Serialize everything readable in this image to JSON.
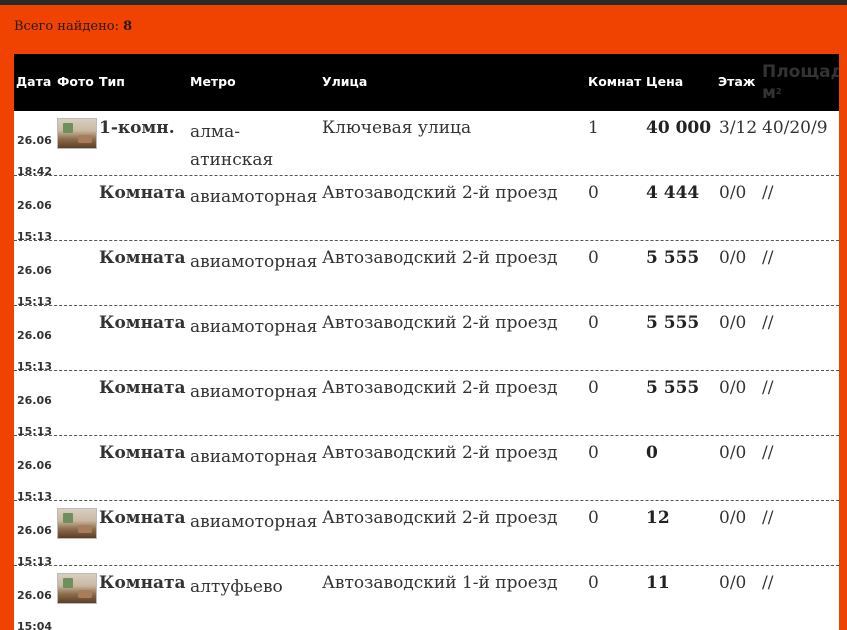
{
  "summary": {
    "label": "Всего найдено:",
    "count": "8"
  },
  "columns": {
    "date": "Дата",
    "photo": "Фото",
    "type": "Тип",
    "metro": "Метро",
    "street": "Улица",
    "rooms": "Комнат",
    "price": "Цена",
    "floor": "Этаж",
    "area": "Площадь",
    "area_unit": "м",
    "area_sup": "2"
  },
  "rows": [
    {
      "date": "26.06",
      "time": "18:42",
      "photo": true,
      "type": "1-комн.",
      "metro": "алма-",
      "metro2": "атинская",
      "street": "Ключевая улица",
      "rooms": "1",
      "price": "40 000",
      "floor": "3/12",
      "area": "40/20/9"
    },
    {
      "date": "26.06",
      "time": "15:13",
      "photo": false,
      "type": "Комната",
      "metro": "авиамоторная",
      "metro2": "",
      "street": "Автозаводский 2-й проезд",
      "rooms": "0",
      "price": "4 444",
      "floor": "0/0",
      "area": "//"
    },
    {
      "date": "26.06",
      "time": "15:13",
      "photo": false,
      "type": "Комната",
      "metro": "авиамоторная",
      "metro2": "",
      "street": "Автозаводский 2-й проезд",
      "rooms": "0",
      "price": "5 555",
      "floor": "0/0",
      "area": "//"
    },
    {
      "date": "26.06",
      "time": "15:13",
      "photo": false,
      "type": "Комната",
      "metro": "авиамоторная",
      "metro2": "",
      "street": "Автозаводский 2-й проезд",
      "rooms": "0",
      "price": "5 555",
      "floor": "0/0",
      "area": "//"
    },
    {
      "date": "26.06",
      "time": "15:13",
      "photo": false,
      "type": "Комната",
      "metro": "авиамоторная",
      "metro2": "",
      "street": "Автозаводский 2-й проезд",
      "rooms": "0",
      "price": "5 555",
      "floor": "0/0",
      "area": "//"
    },
    {
      "date": "26.06",
      "time": "15:13",
      "photo": false,
      "type": "Комната",
      "metro": "авиамоторная",
      "metro2": "",
      "street": "Автозаводский 2-й проезд",
      "rooms": "0",
      "price": "0",
      "floor": "0/0",
      "area": "//"
    },
    {
      "date": "26.06",
      "time": "15:13",
      "photo": true,
      "type": "Комната",
      "metro": "авиамоторная",
      "metro2": "",
      "street": "Автозаводский 2-й проезд",
      "rooms": "0",
      "price": "12",
      "floor": "0/0",
      "area": "//"
    },
    {
      "date": "26.06",
      "time": "15:04",
      "photo": true,
      "type": "Комната",
      "metro": "алтуфьево",
      "metro2": "",
      "street": "Автозаводский 1-й проезд",
      "rooms": "0",
      "price": "11",
      "floor": "0/0",
      "area": "//"
    }
  ]
}
